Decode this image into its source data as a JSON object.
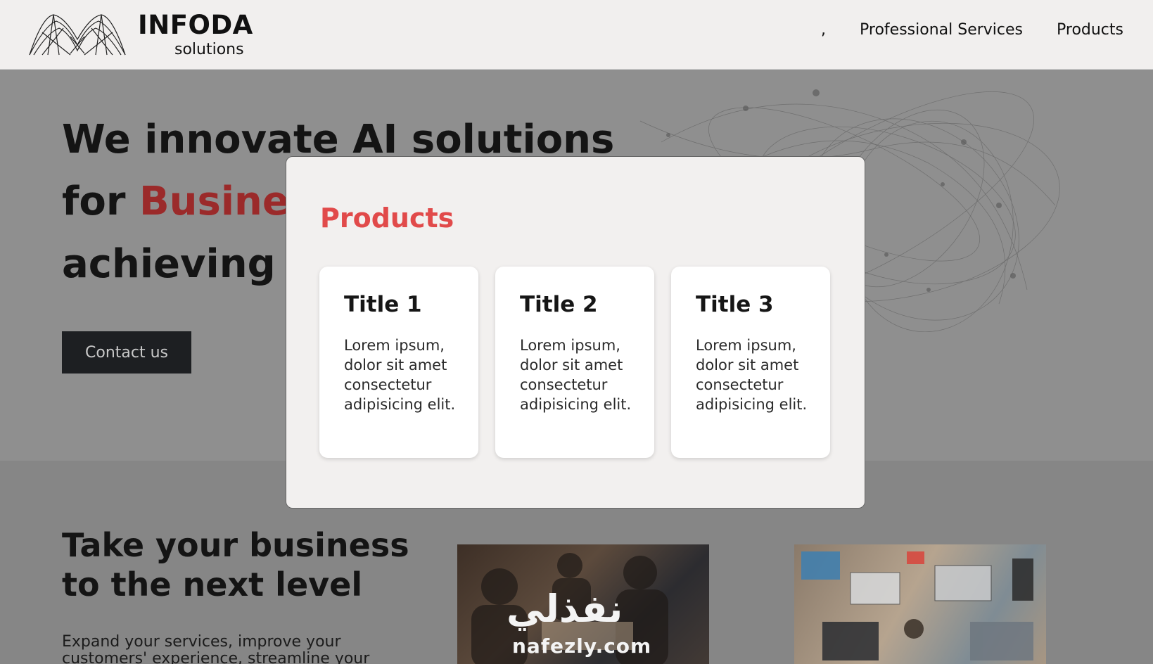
{
  "header": {
    "brand_name": "INFODA",
    "brand_sub": "solutions",
    "nav": {
      "comma": ",",
      "items": [
        "Professional Services",
        "Products"
      ]
    }
  },
  "hero": {
    "line1": "We innovate AI solutions",
    "line2_prefix": "for ",
    "line2_accent": "Business",
    "line3": "achieving your goals",
    "contact_label": "Contact us"
  },
  "lower": {
    "title_line1": "Take your business",
    "title_line2": "to the next level",
    "text_line1": "Expand your services, improve your",
    "text_line2": "customers' experience, streamline your",
    "watermark_ar": "نفذلي",
    "watermark_en": "nafezly.com"
  },
  "modal": {
    "title": "Products",
    "cards": [
      {
        "title": "Title 1",
        "text": "Lorem ipsum, dolor sit amet consectetur adipisicing elit."
      },
      {
        "title": "Title 2",
        "text": "Lorem ipsum, dolor sit amet consectetur adipisicing elit."
      },
      {
        "title": "Title 3",
        "text": "Lorem ipsum, dolor sit amet consectetur adipisicing elit."
      }
    ]
  },
  "colors": {
    "accent_red": "#e14a4a",
    "business_red": "#9b2a2a",
    "button_dark": "#1d1f22",
    "header_bg": "#f1efee"
  }
}
